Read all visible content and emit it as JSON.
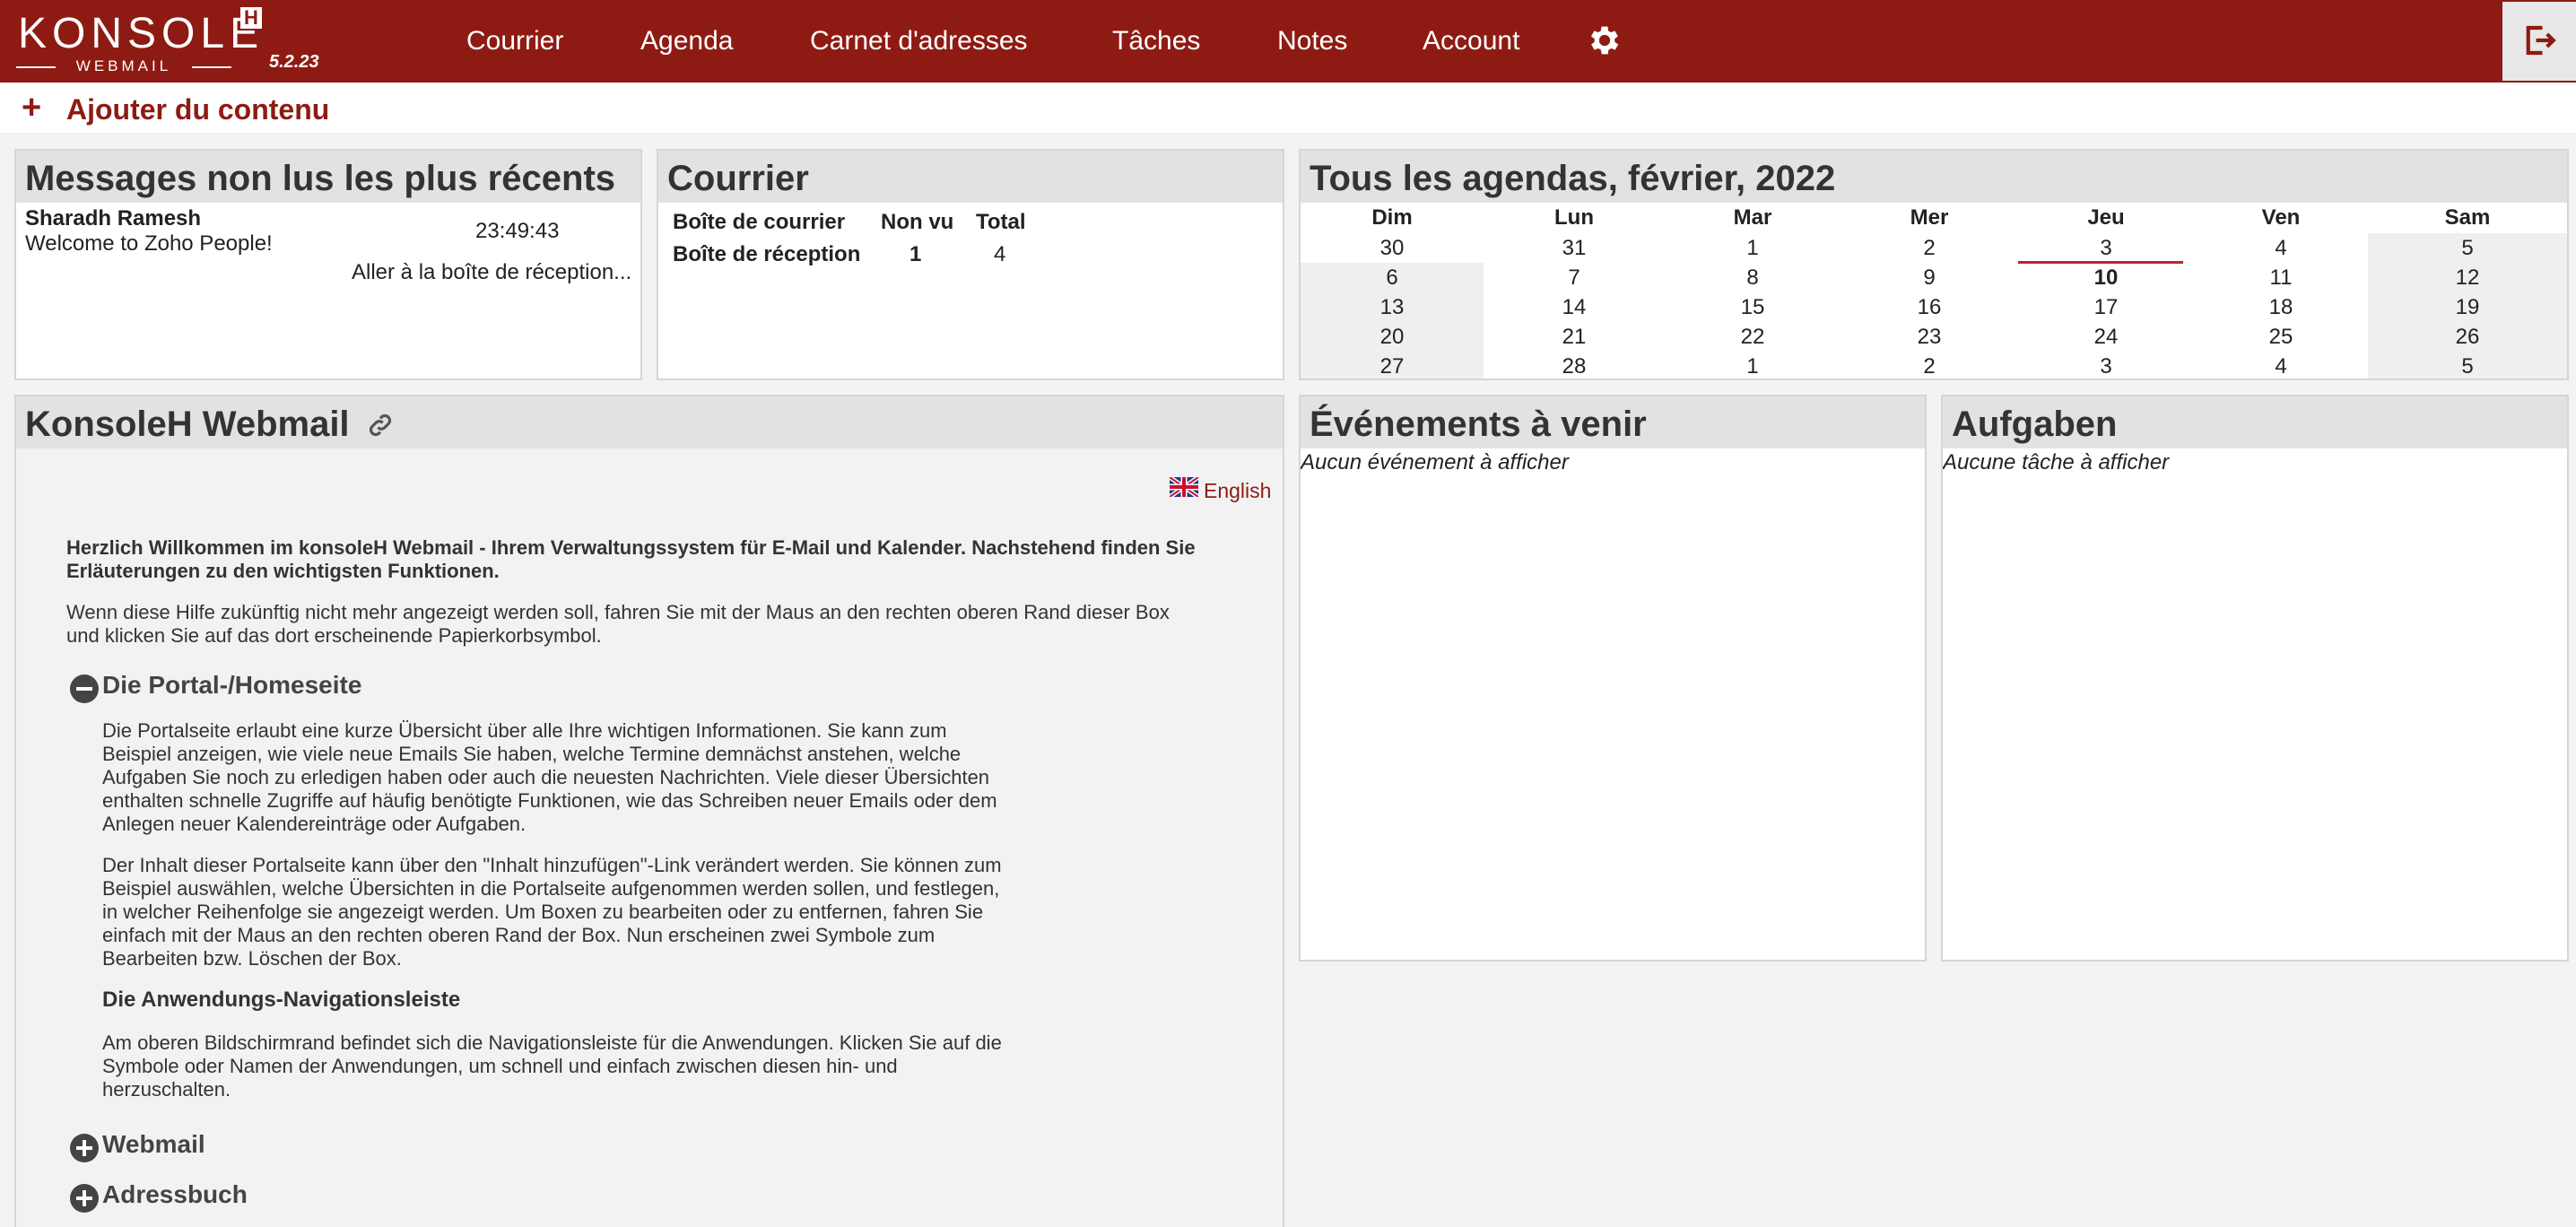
{
  "app": {
    "logo_main": "KONSOLE",
    "logo_badge": "H",
    "logo_sub": "WEBMAIL",
    "version": "5.2.23"
  },
  "nav": {
    "items": [
      "Courrier",
      "Agenda",
      "Carnet d'adresses",
      "Tâches",
      "Notes",
      "Account"
    ],
    "settings_icon": "gear-icon",
    "logout_icon": "logout-icon"
  },
  "add_content": {
    "label": "Ajouter du contenu",
    "icon": "plus-icon"
  },
  "unread": {
    "title": "Messages non lus les plus récents",
    "sender": "Sharadh Ramesh",
    "time": "23:49:43",
    "subject": "Welcome to Zoho People!",
    "inbox_link": "Aller à la boîte de réception..."
  },
  "mail": {
    "title": "Courrier",
    "headers": [
      "Boîte de courrier",
      "Non vu",
      "Total"
    ],
    "rows": [
      {
        "name": "Boîte de réception",
        "unseen": "1",
        "total": "4"
      }
    ]
  },
  "calendar": {
    "title": "Tous les agendas, février, 2022",
    "days": [
      "Dim",
      "Lun",
      "Mar",
      "Mer",
      "Jeu",
      "Ven",
      "Sam"
    ],
    "weeks": [
      [
        "30",
        "31",
        "1",
        "2",
        "3",
        "4",
        "5"
      ],
      [
        "6",
        "7",
        "8",
        "9",
        "10",
        "11",
        "12"
      ],
      [
        "13",
        "14",
        "15",
        "16",
        "17",
        "18",
        "19"
      ],
      [
        "20",
        "21",
        "22",
        "23",
        "24",
        "25",
        "26"
      ],
      [
        "27",
        "28",
        "1",
        "2",
        "3",
        "4",
        "5"
      ]
    ],
    "today": "10",
    "accent": "#c0202a"
  },
  "webmail": {
    "title": "KonsoleH Webmail",
    "link_icon": "link-icon",
    "language": "English",
    "intro_bold": "Herzlich Willkommen im konsoleH Webmail - Ihrem Verwaltungssystem für E-Mail und Kalender. Nachstehend finden Sie Erläuterungen zu den wichtigsten Funktionen.",
    "intro": "Wenn diese Hilfe zukünftig nicht mehr angezeigt werden soll, fahren Sie mit der Maus an den rechten oberen Rand dieser Box und klicken Sie auf das dort erscheinende Papierkorbsymbol.",
    "section1_title": "Die Portal-/Homeseite",
    "section1_p1": "Die Portalseite erlaubt eine kurze Übersicht über alle Ihre wichtigen Informationen. Sie kann zum Beispiel anzeigen, wie viele neue Emails Sie haben, welche Termine demnächst anstehen, welche Aufgaben Sie noch zu erledigen haben oder auch die neuesten Nachrichten. Viele dieser Übersichten enthalten schnelle Zugriffe auf häufig benötigte Funktionen, wie das Schreiben neuer Emails oder dem Anlegen neuer Kalendereinträge oder Aufgaben.",
    "section1_p2": "Der Inhalt dieser Portalseite kann über den \"Inhalt hinzufügen\"-Link verändert werden. Sie können zum Beispiel auswählen, welche Übersichten in die Portalseite aufgenommen werden sollen, und festlegen, in welcher Reihenfolge sie angezeigt werden. Um Boxen zu bearbeiten oder zu entfernen, fahren Sie einfach mit der Maus an den rechten oberen Rand der Box. Nun erscheinen zwei Symbole zum Bearbeiten bzw. Löschen der Box.",
    "sub_title": "Die Anwendungs-Navigationsleiste",
    "sub_p": "Am oberen Bildschirmrand befindet sich die Navigationsleiste für die Anwendungen. Klicken Sie auf die Symbole oder Namen der Anwendungen, um schnell und einfach zwischen diesen hin- und herzuschalten.",
    "section2_title": "Webmail",
    "section3_title": "Adressbuch"
  },
  "events": {
    "title": "Événements à venir",
    "empty": "Aucun événement à afficher"
  },
  "tasks": {
    "title": "Aufgaben",
    "empty": "Aucune tâche à afficher"
  },
  "colors": {
    "brand": "#8e1b13",
    "panel_head": "#e2e2e2"
  }
}
